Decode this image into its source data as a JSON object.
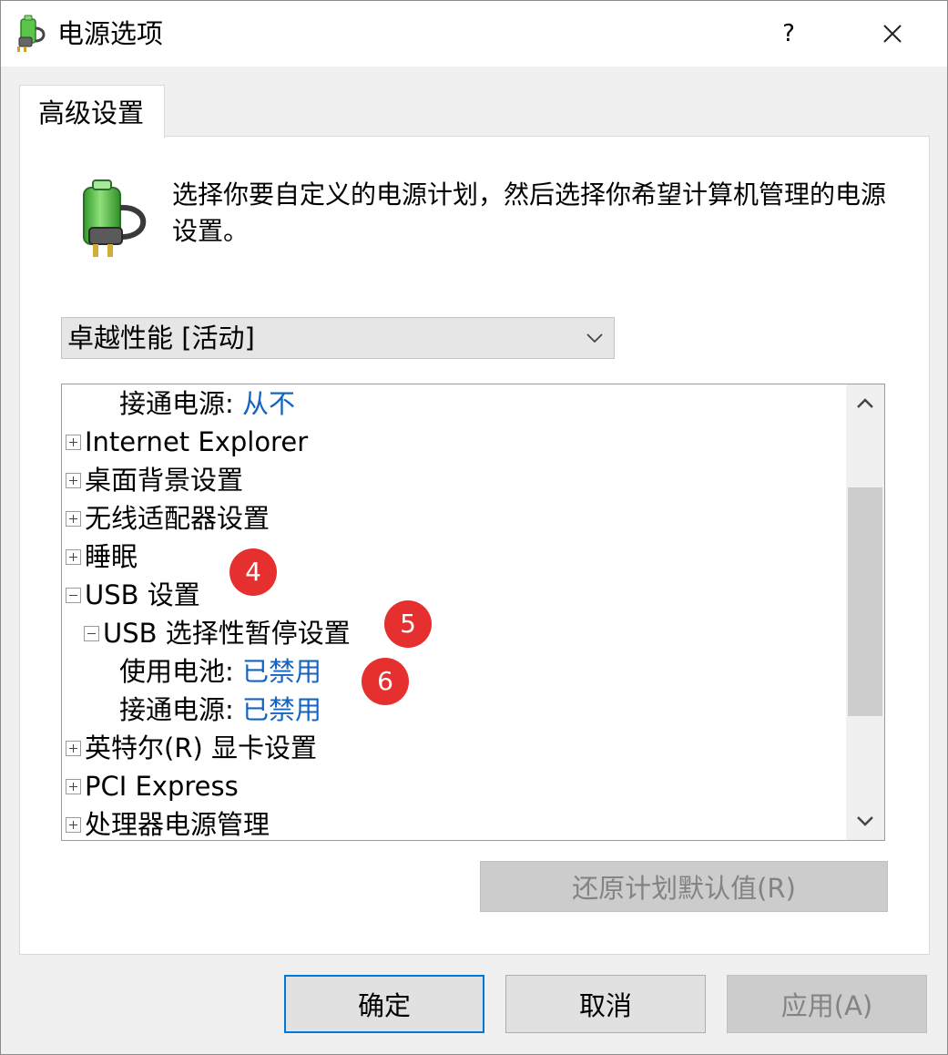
{
  "window": {
    "title": "电源选项",
    "help_label": "?",
    "close_icon": "close-icon"
  },
  "tab": {
    "label": "高级设置"
  },
  "description": "选择你要自定义的电源计划，然后选择你希望计算机管理的电源设置。",
  "plan_select": {
    "value": "卓越性能 [活动]"
  },
  "tree": {
    "items": [
      {
        "indent": 2,
        "label": "接通电源:",
        "value": "从不"
      },
      {
        "indent": 0,
        "expander": "plus",
        "label": "Internet Explorer"
      },
      {
        "indent": 0,
        "expander": "plus",
        "label": "桌面背景设置"
      },
      {
        "indent": 0,
        "expander": "plus",
        "label": "无线适配器设置"
      },
      {
        "indent": 0,
        "expander": "plus",
        "label": "睡眠"
      },
      {
        "indent": 0,
        "expander": "minus",
        "label": "USB 设置"
      },
      {
        "indent": 1,
        "expander": "minus",
        "label": "USB 选择性暂停设置"
      },
      {
        "indent": 2,
        "label": "使用电池:",
        "value": "已禁用"
      },
      {
        "indent": 2,
        "label": "接通电源:",
        "value": "已禁用"
      },
      {
        "indent": 0,
        "expander": "plus",
        "label": "英特尔(R) 显卡设置"
      },
      {
        "indent": 0,
        "expander": "plus",
        "label": "PCI Express"
      },
      {
        "indent": 0,
        "expander": "plus",
        "label": "处理器电源管理"
      }
    ]
  },
  "callouts": [
    "4",
    "5",
    "6"
  ],
  "buttons": {
    "restore": "还原计划默认值(R)",
    "ok": "确定",
    "cancel": "取消",
    "apply": "应用(A)"
  },
  "colors": {
    "link": "#1565c0",
    "callout": "#e63030",
    "focus_border": "#0078d7"
  }
}
